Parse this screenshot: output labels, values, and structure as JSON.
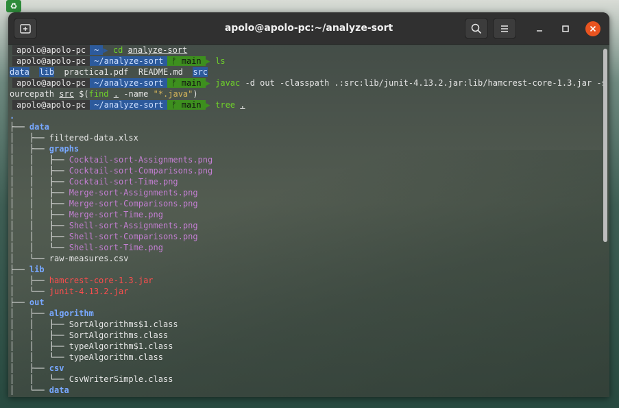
{
  "window": {
    "title": "apolo@apolo-pc:~/analyze-sort"
  },
  "titlebar": {
    "newtab_icon": "new-tab-icon",
    "search_icon": "search-icon",
    "menu_icon": "hamburger-menu-icon",
    "minimize_icon": "minimize-icon",
    "maximize_icon": "maximize-icon",
    "close_icon": "close-icon"
  },
  "prompt": {
    "user": "apolo@apolo-pc",
    "home_dir": "~",
    "dir": "~/analyze-sort",
    "branch": "main",
    "branch_glyph": "ᚠ"
  },
  "commands": {
    "c1_cmd": "cd",
    "c1_arg": "analyze-sort",
    "c2_cmd": "ls",
    "c3_cmd": "javac",
    "c3_args": " -d out -classpath .:src:lib/junit-4.13.2.jar:lib/hamcrest-core-1.3.jar -s",
    "c3_wrap_pre": "ourcepath ",
    "c3_wrap_src": "src",
    "c3_wrap_sub_open": " $(",
    "c3_wrap_find": "find",
    "c3_wrap_dot": ".",
    "c3_wrap_name": " -name ",
    "c3_wrap_str": "\"*.java\"",
    "c3_wrap_close": ")",
    "c4_cmd": "tree",
    "c4_arg": "."
  },
  "ls_output": {
    "data": "data",
    "lib": "lib",
    "pdf": "practica1.pdf",
    "readme": "README.md",
    "src": "src"
  },
  "tree_output": [
    {
      "prefix": "",
      "name": "."
    },
    {
      "prefix": "├── ",
      "name": "data"
    },
    {
      "prefix": "│   ├── ",
      "name": "filtered-data.xlsx"
    },
    {
      "prefix": "│   ├── ",
      "name": "graphs"
    },
    {
      "prefix": "│   │   ├── ",
      "name": "Cocktail-sort-Assignments.png"
    },
    {
      "prefix": "│   │   ├── ",
      "name": "Cocktail-sort-Comparisons.png"
    },
    {
      "prefix": "│   │   ├── ",
      "name": "Cocktail-sort-Time.png"
    },
    {
      "prefix": "│   │   ├── ",
      "name": "Merge-sort-Assignments.png"
    },
    {
      "prefix": "│   │   ├── ",
      "name": "Merge-sort-Comparisons.png"
    },
    {
      "prefix": "│   │   ├── ",
      "name": "Merge-sort-Time.png"
    },
    {
      "prefix": "│   │   ├── ",
      "name": "Shell-sort-Assignments.png"
    },
    {
      "prefix": "│   │   ├── ",
      "name": "Shell-sort-Comparisons.png"
    },
    {
      "prefix": "│   │   └── ",
      "name": "Shell-sort-Time.png"
    },
    {
      "prefix": "│   └── ",
      "name": "raw-measures.csv"
    },
    {
      "prefix": "├── ",
      "name": "lib"
    },
    {
      "prefix": "│   ├── ",
      "name": "hamcrest-core-1.3.jar"
    },
    {
      "prefix": "│   └── ",
      "name": "junit-4.13.2.jar"
    },
    {
      "prefix": "├── ",
      "name": "out"
    },
    {
      "prefix": "│   ├── ",
      "name": "algorithm"
    },
    {
      "prefix": "│   │   ├── ",
      "name": "SortAlgorithms$1.class"
    },
    {
      "prefix": "│   │   ├── ",
      "name": "SortAlgorithms.class"
    },
    {
      "prefix": "│   │   ├── ",
      "name": "typeAlgorithm$1.class"
    },
    {
      "prefix": "│   │   └── ",
      "name": "typeAlgorithm.class"
    },
    {
      "prefix": "│   ├── ",
      "name": "csv"
    },
    {
      "prefix": "│   │   └── ",
      "name": "CsvWriterSimple.class"
    },
    {
      "prefix": "│   └── ",
      "name": "data"
    }
  ],
  "colors": {
    "accent_close": "#e95420",
    "dir_segment": "#2c5a9c",
    "git_segment": "#3d8f1e",
    "command_green": "#6fd12a",
    "png_magenta": "#c47fd3",
    "jar_red": "#ff4d4d",
    "dir_blue": "#78a8ff"
  }
}
